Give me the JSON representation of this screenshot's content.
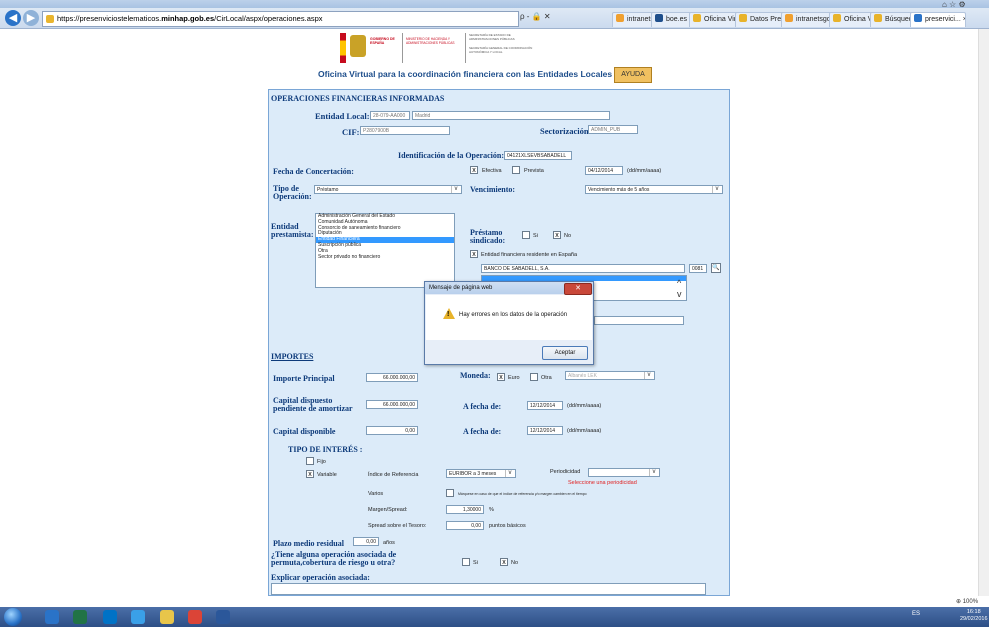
{
  "browser": {
    "url_prefix": "https://presenviciostelematicos.",
    "url_host": "minhap.gob.es",
    "url_path": "/CirLocal/aspx/operaciones.aspx",
    "address_tools": "ρ - 🔒 ✕",
    "tabs": [
      {
        "label": "intranetsgcal...",
        "color": "#f0a030"
      },
      {
        "label": "boe.es",
        "color": "#1f4f8c"
      },
      {
        "label": "Oficina Virtu...",
        "color": "#e8b32a"
      },
      {
        "label": "Datos Presup...",
        "color": "#e8b32a"
      },
      {
        "label": "intranetsgcal...",
        "color": "#f0a030"
      },
      {
        "label": "Oficina Virtu...",
        "color": "#e8b32a"
      },
      {
        "label": "Búsqueda",
        "color": "#e8b32a"
      },
      {
        "label": "preservici...",
        "color": "#2a73c8"
      }
    ],
    "tab_close": "×",
    "window_controls": "⌂ ☆ ⚙"
  },
  "banner": {
    "gobierno": "GOBIERNO DE ESPAÑA",
    "ministerio": "MINISTERIO DE HACIENDA Y ADMINISTRACIONES PÚBLICAS",
    "secretaria": "SECRETARÍA DE ESTADO DE ADMINISTRACIONES PÚBLICAS",
    "secretaria_general": "SECRETARÍA GENERAL DE COORDINACIÓN AUTONÓMICA Y LOCAL",
    "title": "Oficina Virtual para la coordinación financiera con las Entidades Locales",
    "help": "AYUDA"
  },
  "form": {
    "section_title": "OPERACIONES FINANCIERAS INFORMADAS",
    "entidad_local_label": "Entidad Local:",
    "entidad_code": "28-079-AA000",
    "entidad_name": "Madrid",
    "cif_label": "CIF:",
    "cif_value": "P2807900B",
    "sectorizacion_label": "Sectorización",
    "sectorizacion_value": "ADMIN_PUB",
    "identificacion_label": "Identificación de la Operación:",
    "identificacion_value": "04121XLSEVBSABADELL",
    "fecha_label": "Fecha de Concertación:",
    "efectiva_label": "Efectiva",
    "prevista_label": "Prevista",
    "fecha_value": "04/12/2014",
    "fecha_format": "(dd/mm/aaaa)",
    "tipo_label": "Tipo de Operación:",
    "tipo_value": "Préstamo",
    "vencimiento_label": "Vencimiento:",
    "vencimiento_value": "Vencimiento más de 5 años",
    "entidad_prestamista_label": "Entidad prestamista:",
    "prestamistas": [
      "Administración General del Estado",
      "Comunidad Autónoma",
      "Consorcio de saneamiento financiero",
      "Diputación",
      "Entidad Financiera",
      "Suscripción pública",
      "Otra",
      "Sector privado no financiero"
    ],
    "prestamista_selected": 4,
    "sindicado_label": "Préstamo sindicado:",
    "si_label": "Si",
    "no_label": "No",
    "residente_label": "Entidad financiera residente en España",
    "banco_value": "BANCO DE SABADELL, S.A.",
    "banco_code": "0081",
    "check_mark": "x",
    "search_glyph": "🔍",
    "scroll_up": "^",
    "scroll_down": "v",
    "dropdown_arrow": "v"
  },
  "importes": {
    "title": "IMPORTES",
    "principal_label": "Importe Principal",
    "principal_value": "66.000.000,00",
    "moneda_label": "Moneda:",
    "euro_label": "Euro",
    "otra_label": "Otra",
    "otra_select": "Albanés LEK",
    "dispuesto_label": "Capital dispuesto pendiente de amortizar",
    "dispuesto_value": "66.000.000,00",
    "afecha_label": "A fecha de:",
    "afecha1_value": "12/12/2014",
    "afecha_format": "(dd/mm/aaaa)",
    "disponible_label": "Capital disponible",
    "disponible_value": "0,00",
    "afecha2_value": "12/12/2014",
    "tipo_interes_label": "TIPO DE INTERÉS :",
    "fijo_label": "Fijo",
    "variable_label": "Variable",
    "indice_label": "Índice de Referencia",
    "indice_value": "EURIBOR a 3 meses",
    "periodicidad_label": "Periodicidad",
    "periodicidad_error": "Seleccione una periodicidad",
    "varios_label": "Varios",
    "varios_help": "Márquese en caso de que el índice de referencia y/o margen cambien en el tiempo",
    "margen_label": "Margen/Spread:",
    "margen_value": "1,30000",
    "margen_unit": "%",
    "spread_label": "Spread sobre el Tesoro:",
    "spread_value": "0,00",
    "spread_unit": "puntos básicos",
    "plazo_label": "Plazo medio residual",
    "plazo_value": "0,00",
    "plazo_unit": "años",
    "permuta_label": "¿Tiene alguna operación asociada de permuta,cobertura de riesgo u otra?",
    "si_label": "Si",
    "no_label": "No",
    "explicar_label": "Explicar operación asociada:"
  },
  "dialog": {
    "title": "Mensaje de página web",
    "close": "✕",
    "warning_mark": "!",
    "message": "Hay errores en los datos de la operación",
    "ok": "Aceptar"
  },
  "status": {
    "zoom": "⊕ 100%"
  },
  "taskbar": {
    "tray": "ES",
    "time": "16:18",
    "date": "29/02/2016",
    "icons": [
      {
        "name": "media-player-icon",
        "color": "#2a73c8"
      },
      {
        "name": "excel-icon",
        "color": "#217346"
      },
      {
        "name": "outlook-icon",
        "color": "#0072c6"
      },
      {
        "name": "internet-explorer-icon",
        "color": "#3aa0e8"
      },
      {
        "name": "file-explorer-icon",
        "color": "#e8c54a"
      },
      {
        "name": "chrome-icon",
        "color": "#db4437"
      },
      {
        "name": "word-icon",
        "color": "#2b579a"
      }
    ]
  },
  "colors": {
    "panel": "#dcebf9",
    "label": "#0d3a7a",
    "error": "#e02020",
    "selection": "#3399ff"
  }
}
